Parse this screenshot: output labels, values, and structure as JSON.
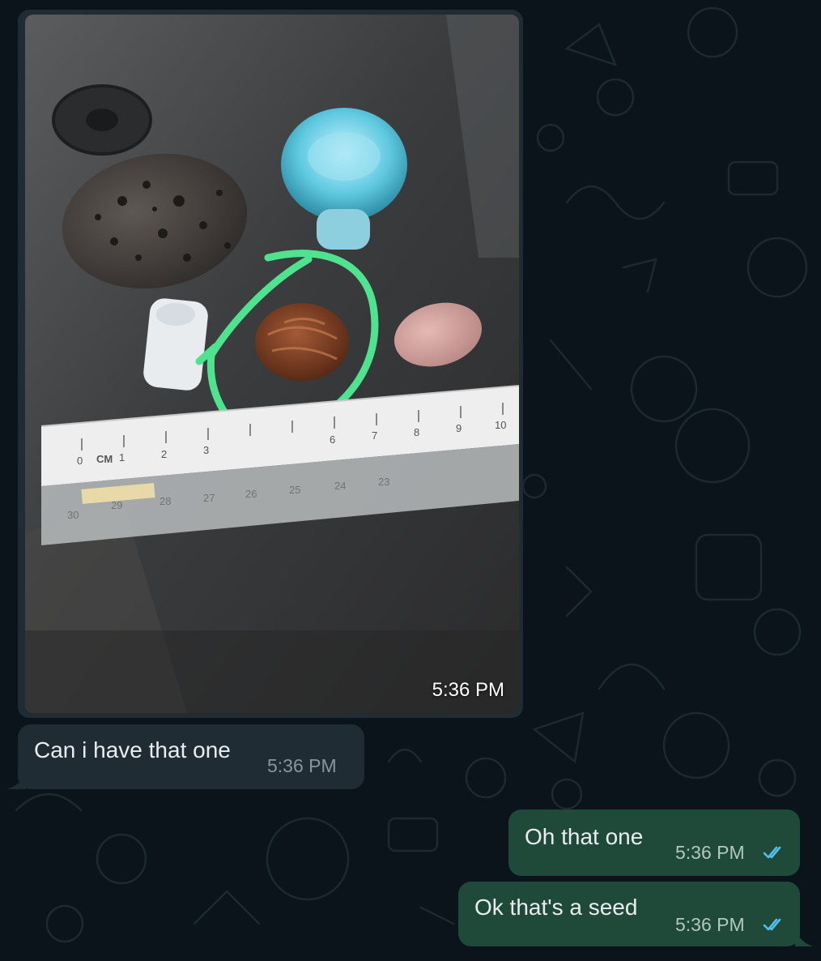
{
  "colors": {
    "background": "#0b141a",
    "incoming_bubble": "#202c33",
    "outgoing_bubble": "#1f4a3a",
    "read_ticks": "#53bdeb",
    "circle_annotation": "#4fe38f"
  },
  "image_message": {
    "time": "5:36 PM",
    "ruler_marks_cm": [
      "0",
      "CM",
      "1",
      "2",
      "3",
      "6",
      "7",
      "8",
      "9",
      "10"
    ],
    "ruler_marks_lower": [
      "30",
      "29",
      "28",
      "27",
      "26",
      "25",
      "24",
      "23"
    ]
  },
  "messages": [
    {
      "direction": "incoming",
      "text": "Can i have that one",
      "time": "5:36 PM"
    },
    {
      "direction": "outgoing",
      "text": "Oh that one",
      "time": "5:36 PM",
      "status_icon": "double-check-icon"
    },
    {
      "direction": "outgoing",
      "text": "Ok that's a seed",
      "time": "5:36 PM",
      "status_icon": "double-check-icon"
    }
  ]
}
